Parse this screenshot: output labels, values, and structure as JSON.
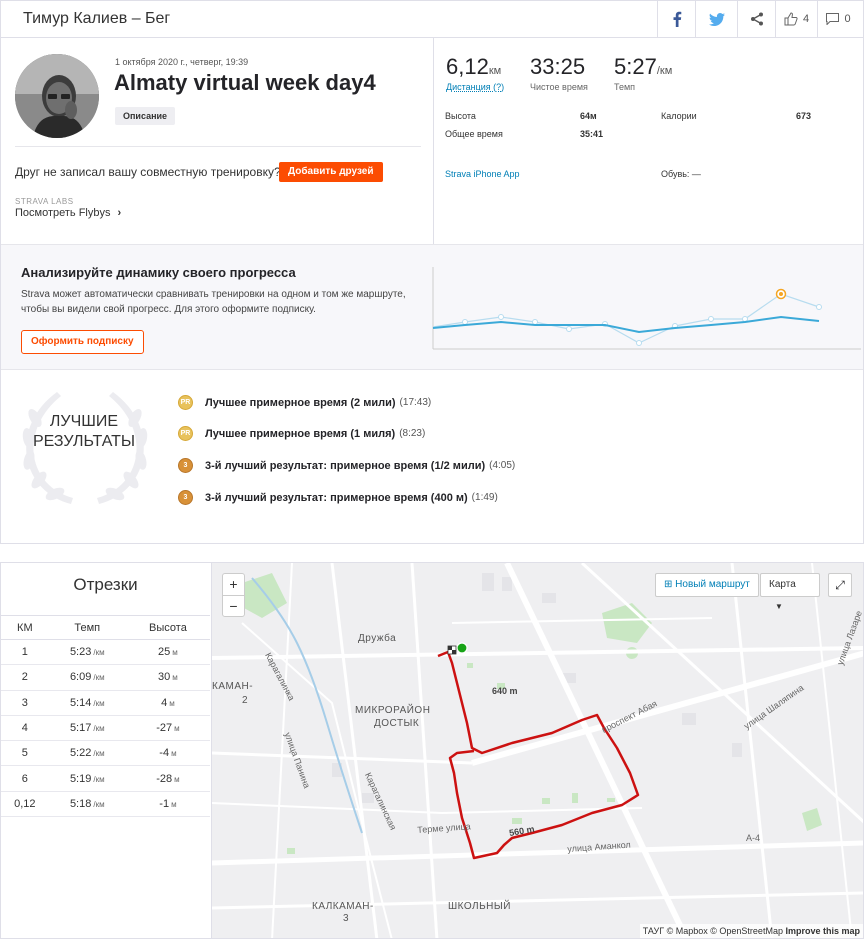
{
  "header": {
    "title": "Тимур Калиев – Бег",
    "kudos_count": "4",
    "comments_count": "0"
  },
  "activity": {
    "date": "1 октября 2020 г., четверг, 19:39",
    "name": "Almaty virtual week day4",
    "description_button": "Описание",
    "friend_prompt": "Друг не записал вашу совместную тренировку?",
    "add_friends_button": "Добавить друзей",
    "labs_label": "STRAVA LABS",
    "flybys_link": "Посмотреть Flybys"
  },
  "stats": {
    "distance_value": "6,12",
    "distance_unit": "км",
    "distance_label": "Дистанция (?)",
    "moving_time_value": "33:25",
    "moving_time_label": "Чистое время",
    "pace_value": "5:27",
    "pace_unit": "/км",
    "pace_label": "Темп",
    "elevation_label": "Высота",
    "elevation_value": "64м",
    "calories_label": "Калории",
    "calories_value": "673",
    "elapsed_label": "Общее время",
    "elapsed_value": "35:41",
    "device": "Strava iPhone App",
    "shoes_label": "Обувь: —"
  },
  "upsell": {
    "title": "Анализируйте динамику своего прогресса",
    "text": "Strava может автоматически сравнивать тренировки на одном и том же маршруте, чтобы вы видели свой прогресс. Для этого оформите подписку.",
    "button": "Оформить подписку"
  },
  "best_efforts": {
    "title_line1": "ЛУЧШИЕ",
    "title_line2": "РЕЗУЛЬТАТЫ",
    "items": [
      {
        "medal": "PR",
        "label": "Лучшее примерное время (2 мили)",
        "time": "(17:43)"
      },
      {
        "medal": "PR",
        "label": "Лучшее примерное время (1 миля)",
        "time": "(8:23)"
      },
      {
        "medal": "3",
        "label": "3-й лучший результат: примерное время (1/2 мили)",
        "time": "(4:05)"
      },
      {
        "medal": "3",
        "label": "3-й лучший результат: примерное время (400 м)",
        "time": "(1:49)"
      }
    ]
  },
  "splits": {
    "title": "Отрезки",
    "headers": [
      "КМ",
      "Темп",
      "Высота"
    ],
    "pace_unit": "/км",
    "elev_unit": "м",
    "rows": [
      {
        "km": "1",
        "pace": "5:23",
        "elev": "25"
      },
      {
        "km": "2",
        "pace": "6:09",
        "elev": "30"
      },
      {
        "km": "3",
        "pace": "5:14",
        "elev": "4"
      },
      {
        "km": "4",
        "pace": "5:17",
        "elev": "-27"
      },
      {
        "km": "5",
        "pace": "5:22",
        "elev": "-4"
      },
      {
        "km": "6",
        "pace": "5:19",
        "elev": "-28"
      },
      {
        "km": "0,12",
        "pace": "5:18",
        "elev": "-1"
      }
    ]
  },
  "map": {
    "new_route": "Новый маршрут",
    "map_type": "Карта",
    "attribution_prefix": "ТАУГ © Mapbox © OpenStreetMap",
    "attribution_improve": "Improve this map",
    "labels": {
      "druzhba": "Дружба",
      "mikro1": "МИКРОРАЙОН",
      "mikro2": "ДОСТЫК",
      "kamen": "КАМАН-",
      "kamen2": "2",
      "kalkaman": "КАЛКАМАН-",
      "kalkaman3": "3",
      "shkolny": "ШКОЛЬНЫЙ",
      "karagalinka": "Карагалинка",
      "karagalinskaya": "Карагалинская",
      "abaya": "проспект Абая",
      "shalyapina": "улица Шаляпина",
      "panina": "улица Панина",
      "terme": "Терме улица",
      "amankol": "улица Аманкол",
      "lazar": "улица Лазаре",
      "a4": "А-4",
      "m640": "640 m",
      "m560": "560 m"
    }
  }
}
